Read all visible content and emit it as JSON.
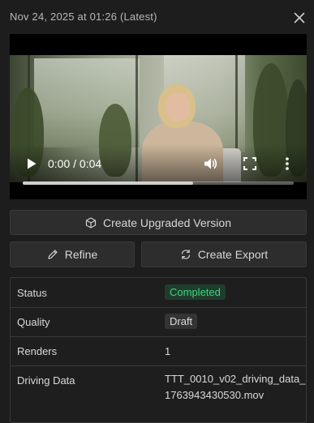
{
  "header": {
    "title": "Nov 24, 2025 at 01:26 (Latest)"
  },
  "video": {
    "time_display": "0:00 / 0:04",
    "progress_fraction": 0,
    "buffered_fraction": 0.63
  },
  "actions": {
    "create_upgraded_label": "Create Upgraded Version",
    "refine_label": "Refine",
    "create_export_label": "Create Export"
  },
  "details": {
    "rows": [
      {
        "label": "Status",
        "value": "Completed"
      },
      {
        "label": "Quality",
        "value": "Draft"
      },
      {
        "label": "Renders",
        "value": "1"
      },
      {
        "label": "Driving Data",
        "value_line1": "TTT_0010_v02_driving_data_",
        "value_line2": "1763943430530.mov"
      }
    ]
  },
  "colors": {
    "status_completed_text": "#44d27f",
    "status_completed_bg": "#1f3d2c",
    "background": "#1d1d1d"
  },
  "icons": [
    "close-icon",
    "play-icon",
    "volume-icon",
    "fullscreen-icon",
    "more-vertical-icon",
    "cube-icon",
    "pencil-icon",
    "refresh-icon"
  ]
}
